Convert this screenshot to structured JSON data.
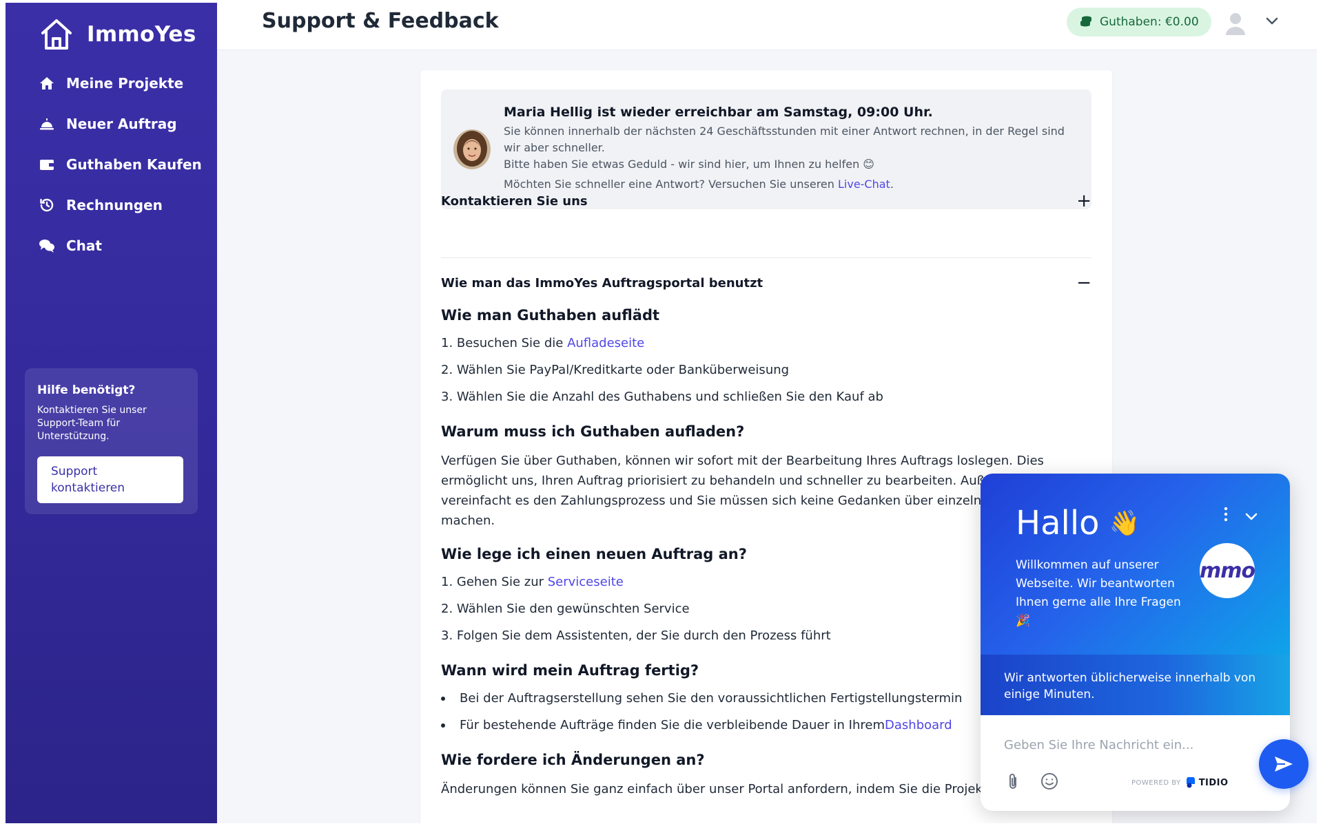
{
  "app": {
    "name": "ImmoYes"
  },
  "sidebar": {
    "items": [
      {
        "label": "Meine Projekte",
        "icon": "home-icon"
      },
      {
        "label": "Neuer Auftrag",
        "icon": "bell-service-icon"
      },
      {
        "label": "Guthaben Kaufen",
        "icon": "wallet-icon"
      },
      {
        "label": "Rechnungen",
        "icon": "history-icon"
      },
      {
        "label": "Chat",
        "icon": "chat-bubbles-icon"
      }
    ],
    "help": {
      "title": "Hilfe benötigt?",
      "text": "Kontaktieren Sie unser Support-Team für Unterstützung.",
      "button": "Support kontaktieren"
    }
  },
  "header": {
    "title": "Support & Feedback",
    "balance": "Guthaben: €0.00"
  },
  "notice": {
    "title": "Maria Hellig ist wieder erreichbar am Samstag, 09:00 Uhr.",
    "line1": "Sie können innerhalb der nächsten 24 Geschäftsstunden mit einer Antwort rechnen, in der Regel sind wir aber schneller.",
    "line2": "Bitte haben Sie etwas Geduld - wir sind hier, um Ihnen zu helfen 😊",
    "live_prefix": "Möchten Sie schneller eine Antwort? Versuchen Sie unseren ",
    "live_link": "Live-Chat",
    "live_suffix": "."
  },
  "accordion": [
    {
      "label": "Kontaktieren Sie uns",
      "sign": "+"
    },
    {
      "label": "Wie man das ImmoYes Auftragsportal benutzt",
      "sign": "−"
    }
  ],
  "faq": {
    "s1_title": "Wie man Guthaben auflädt",
    "s1_step1_prefix": "1. Besuchen Sie die ",
    "s1_step1_link": "Aufladeseite",
    "s1_step2": "2. Wählen Sie PayPal/Kreditkarte oder Banküberweisung",
    "s1_step3": "3. Wählen Sie die Anzahl des Guthabens und schließen Sie den Kauf ab",
    "s2_title": "Warum muss ich Guthaben aufladen?",
    "s2_text": "Verfügen Sie über Guthaben, können wir sofort mit der Bearbeitung Ihres Auftrags loslegen. Dies ermöglicht uns, Ihren Auftrag priorisiert zu behandeln und schneller zu bearbeiten. Außerdem vereinfacht es den Zahlungsprozess und Sie müssen sich keine Gedanken über einzelne Rechnungen machen.",
    "s3_title": "Wie lege ich einen neuen Auftrag an?",
    "s3_step1_prefix": "1. Gehen Sie zur ",
    "s3_step1_link": "Serviceseite",
    "s3_step2": "2. Wählen Sie den gewünschten Service",
    "s3_step3": "3. Folgen Sie dem Assistenten, der Sie durch den Prozess führt",
    "s4_title": "Wann wird mein Auftrag fertig?",
    "s4_bullet1": "Bei der Auftragserstellung sehen Sie den voraussichtlichen Fertigstellungstermin",
    "s4_bullet2_prefix": "Für bestehende Aufträge finden Sie die verbleibende Dauer in Ihrem ",
    "s4_bullet2_link": "Dashboard",
    "s5_title": "Wie fordere ich Änderungen an?",
    "s5_text": "Änderungen können Sie ganz einfach über unser Portal anfordern, indem Sie die Projektseite aufrufen:"
  },
  "chat": {
    "greeting": "Hallo",
    "wave": "👋",
    "description": "Willkommen auf unserer Webseite. Wir beantworten Ihnen gerne alle Ihre Fragen 🎉",
    "logo_text": "mmo",
    "reply_info": "Wir antworten üblicherweise innerhalb von einige Minuten.",
    "input_placeholder": "Geben Sie Ihre Nachricht ein...",
    "powered_by": "POWERED BY",
    "brand": "TIDIO"
  },
  "colors": {
    "sidebar": "#3b2fa8",
    "accent": "#4f46e5",
    "chat": "#1e5bf0",
    "balance_bg": "#d9f5e2"
  }
}
